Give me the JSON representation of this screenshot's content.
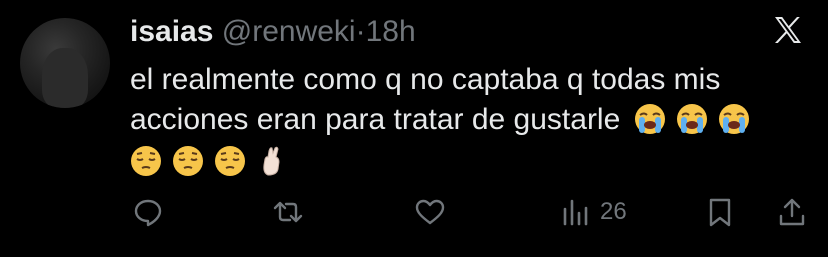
{
  "tweet": {
    "author_name": "isaias",
    "author_handle": "@renweki",
    "separator": "·",
    "time": "18h",
    "text_line1": "el realmente como q no captaba q todas mis",
    "text_line2": "acciones eran para tratar de gustarle",
    "emoji_row1": [
      "loudly-crying-face",
      "loudly-crying-face",
      "loudly-crying-face"
    ],
    "emoji_row2": [
      "pensive-face",
      "pensive-face",
      "pensive-face",
      "crossed-fingers"
    ]
  },
  "actions": {
    "reply_icon": "reply-icon",
    "retweet_icon": "retweet-icon",
    "like_icon": "like-icon",
    "views_icon": "views-icon",
    "views_count": "26",
    "bookmark_icon": "bookmark-icon",
    "share_icon": "share-icon"
  },
  "colors": {
    "background": "#000000",
    "text_primary": "#e7e9ea",
    "text_secondary": "#71767b"
  }
}
